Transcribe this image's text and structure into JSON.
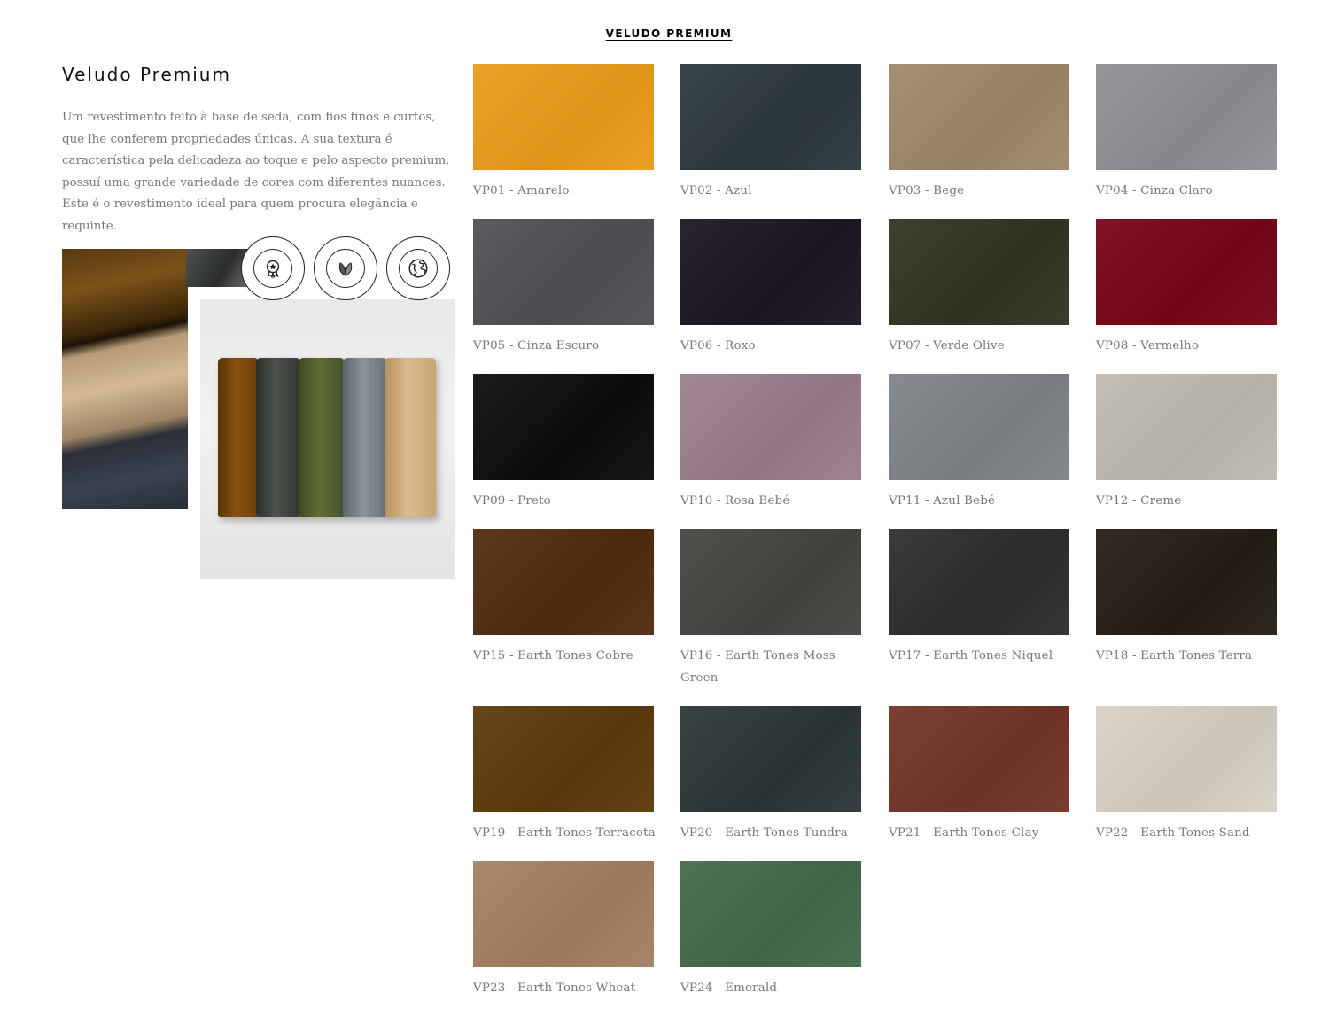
{
  "header": {
    "link_label": "VELUDO PREMIUM"
  },
  "intro": {
    "title": "Veludo Premium",
    "description": "Um revestimento feito à base de seda, com fios finos e curtos, que lhe conferem propriedades únicas. A sua textura é característica pela delicadeza ao toque e pelo aspecto premium, possuí uma grande variedade de cores com diferentes nuances. Este é o revestimento ideal para quem procura elegância e requinte."
  },
  "badges": [
    {
      "icon": "premium-award-icon"
    },
    {
      "icon": "vegan-leaf-icon"
    },
    {
      "icon": "eco-globe-icon"
    }
  ],
  "swatches": [
    {
      "label": "VP01 - Amarelo",
      "color": "#eb9c1a"
    },
    {
      "label": "VP02 - Azul",
      "color": "#2c3840"
    },
    {
      "label": "VP03 - Bege",
      "color": "#9e8a6c"
    },
    {
      "label": "VP04 - Cinza Claro",
      "color": "#8f9093"
    },
    {
      "label": "VP05 - Cinza Escuro",
      "color": "#505155"
    },
    {
      "label": "VP06 - Roxo",
      "color": "#1c1624"
    },
    {
      "label": "VP07 - Verde Olive",
      "color": "#313520"
    },
    {
      "label": "VP08 - Vermelho",
      "color": "#770515"
    },
    {
      "label": "VP09 - Preto",
      "color": "#0d0d0f"
    },
    {
      "label": "VP10 - Rosa Bebé",
      "color": "#9a7f8c"
    },
    {
      "label": "VP11 - Azul Bebé",
      "color": "#7f8489"
    },
    {
      "label": "VP12 - Creme",
      "color": "#c0bbb0"
    },
    {
      "label": "VP15 - Earth Tones Cobre",
      "color": "#512b10"
    },
    {
      "label": "VP16 - Earth Tones Moss Green",
      "color": "#434640"
    },
    {
      "label": "VP17 - Earth Tones Niquel",
      "color": "#2e2e31"
    },
    {
      "label": "VP18 - Earth Tones Terra",
      "color": "#251e16"
    },
    {
      "label": "VP19 - Earth Tones Terracota",
      "color": "#5d3a0c"
    },
    {
      "label": "VP20 - Earth Tones Tundra",
      "color": "#2d3637"
    },
    {
      "label": "VP21 - Earth Tones Clay",
      "color": "#723528"
    },
    {
      "label": "VP22 - Earth Tones Sand",
      "color": "#d8d2c5"
    },
    {
      "label": "VP23 - Earth Tones Wheat",
      "color": "#a58062"
    },
    {
      "label": "VP24 - Emerald",
      "color": "#436b4a"
    }
  ]
}
